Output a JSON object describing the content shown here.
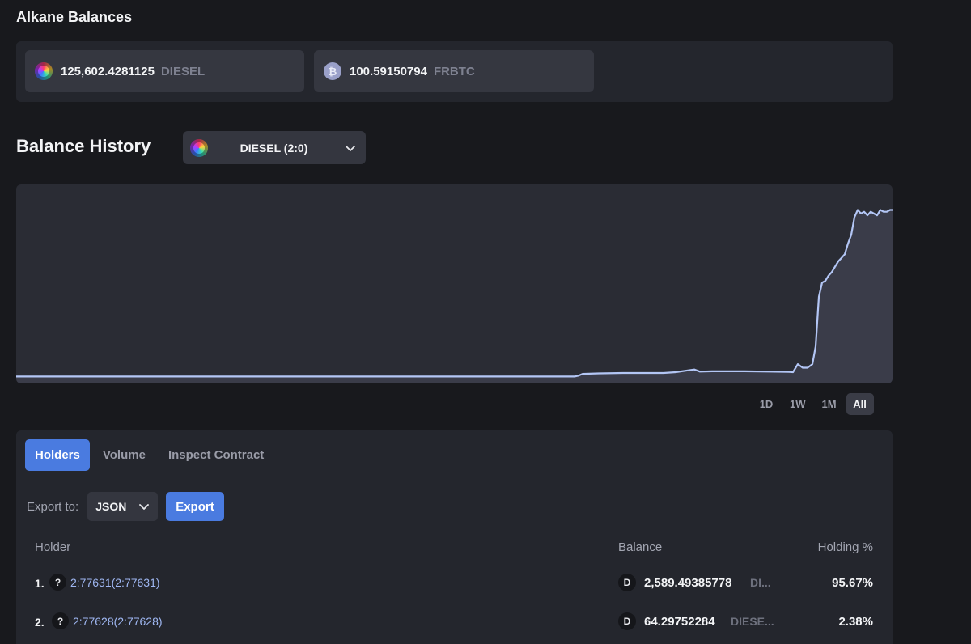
{
  "alkane_balances": {
    "title": "Alkane Balances",
    "items": [
      {
        "amount": "125,602.4281125",
        "symbol": "DIESEL",
        "icon": "diesel-token-icon"
      },
      {
        "amount": "100.59150794",
        "symbol": "FRBTC",
        "icon": "bitcoin-token-icon",
        "icon_glyph": "₿"
      }
    ]
  },
  "balance_history": {
    "title": "Balance History",
    "selected_token": "DIESEL (2:0)",
    "ranges": [
      "1D",
      "1W",
      "1M",
      "All"
    ],
    "active_range": "All"
  },
  "chart_data": {
    "type": "area",
    "title": "",
    "xlabel": "",
    "ylabel": "",
    "grid": false,
    "line_color": "#b3c6f5",
    "x": [
      0,
      100,
      200,
      300,
      400,
      500,
      600,
      690,
      695,
      700,
      720,
      750,
      780,
      800,
      815,
      830,
      838,
      845,
      860,
      880,
      900,
      930,
      955,
      960,
      966,
      972,
      978,
      984,
      988,
      992,
      996,
      1000,
      1004,
      1008,
      1012,
      1016,
      1020,
      1024,
      1028,
      1032,
      1036,
      1040,
      1044,
      1048,
      1052,
      1056,
      1060,
      1064,
      1068,
      1072,
      1076,
      1080,
      1083
    ],
    "values": [
      0.03,
      0.03,
      0.03,
      0.03,
      0.03,
      0.03,
      0.03,
      0.03,
      0.035,
      0.045,
      0.048,
      0.05,
      0.05,
      0.05,
      0.055,
      0.065,
      0.07,
      0.058,
      0.06,
      0.06,
      0.06,
      0.058,
      0.056,
      0.055,
      0.1,
      0.08,
      0.08,
      0.1,
      0.2,
      0.48,
      0.56,
      0.57,
      0.6,
      0.62,
      0.65,
      0.68,
      0.7,
      0.72,
      0.78,
      0.83,
      0.93,
      0.97,
      0.95,
      0.96,
      0.94,
      0.96,
      0.95,
      0.94,
      0.97,
      0.96,
      0.96,
      0.97,
      0.97
    ],
    "ylim": [
      0,
      1.05
    ],
    "xlim": [
      0,
      1083
    ]
  },
  "tabs": {
    "items": [
      "Holders",
      "Volume",
      "Inspect Contract"
    ],
    "active": "Holders"
  },
  "export": {
    "label": "Export to:",
    "format": "JSON",
    "button": "Export"
  },
  "holders_table": {
    "columns": {
      "holder": "Holder",
      "balance": "Balance",
      "pct": "Holding %"
    },
    "rows": [
      {
        "rank": "1.",
        "holder": "2:77631(2:77631)",
        "avatar": "?",
        "token_badge": "D",
        "balance": "2,589.49385778",
        "symbol": "DI...",
        "pct": "95.67%"
      },
      {
        "rank": "2.",
        "holder": "2:77628(2:77628)",
        "avatar": "?",
        "token_badge": "D",
        "balance": "64.29752284",
        "symbol": "DIESE...",
        "pct": "2.38%"
      }
    ]
  }
}
